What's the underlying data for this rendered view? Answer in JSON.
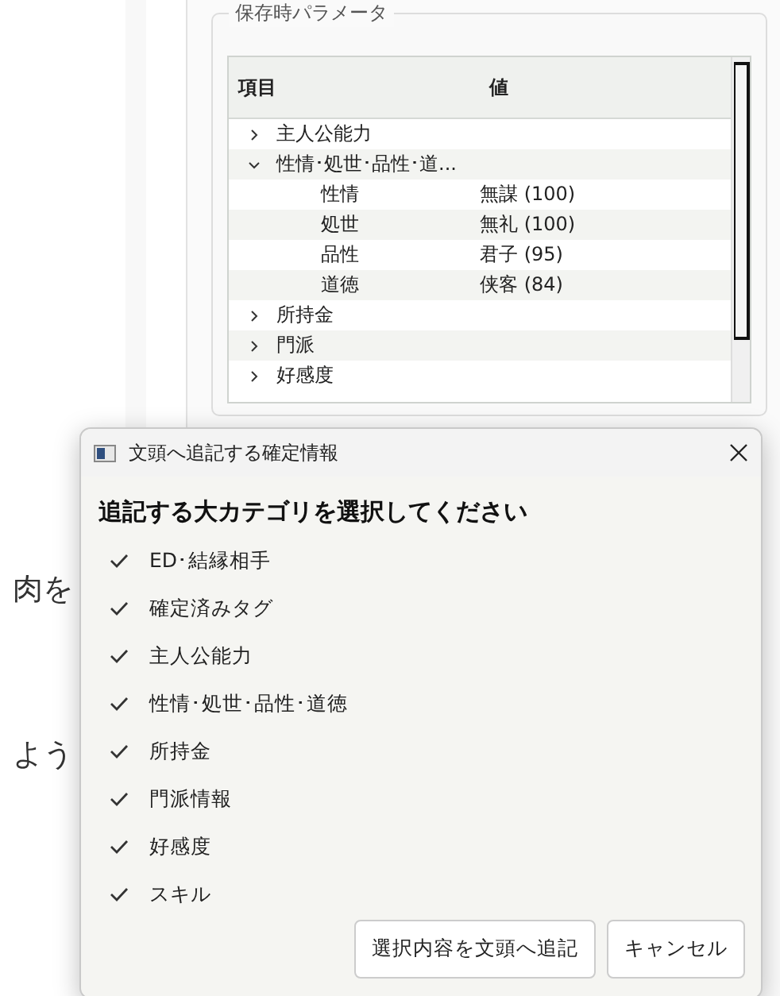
{
  "background_text": [
    "肉を",
    "よう"
  ],
  "group": {
    "title": "保存時パラメータ",
    "tree": {
      "columns": [
        "項目",
        "値"
      ],
      "items": [
        {
          "label": "主人公能力",
          "expanded": false
        },
        {
          "label": "性情･処世･品性･道...",
          "expanded": true,
          "children": [
            {
              "label": "性情",
              "value": "無謀 (100)"
            },
            {
              "label": "処世",
              "value": "無礼 (100)"
            },
            {
              "label": "品性",
              "value": "君子 (95)"
            },
            {
              "label": "道徳",
              "value": "侠客 (84)"
            }
          ]
        },
        {
          "label": "所持金",
          "expanded": false
        },
        {
          "label": "門派",
          "expanded": false
        },
        {
          "label": "好感度",
          "expanded": false
        }
      ]
    }
  },
  "dialog": {
    "title": "文頭へ追記する確定情報",
    "heading": "追記する大カテゴリを選択してください",
    "options": [
      {
        "label": "ED･結縁相手",
        "checked": true
      },
      {
        "label": "確定済みタグ",
        "checked": true
      },
      {
        "label": "主人公能力",
        "checked": true
      },
      {
        "label": "性情･処世･品性･道徳",
        "checked": true
      },
      {
        "label": "所持金",
        "checked": true
      },
      {
        "label": "門派情報",
        "checked": true
      },
      {
        "label": "好感度",
        "checked": true
      },
      {
        "label": "スキル",
        "checked": true
      }
    ],
    "buttons": [
      "選択内容を文頭へ追記",
      "キャンセル"
    ]
  }
}
